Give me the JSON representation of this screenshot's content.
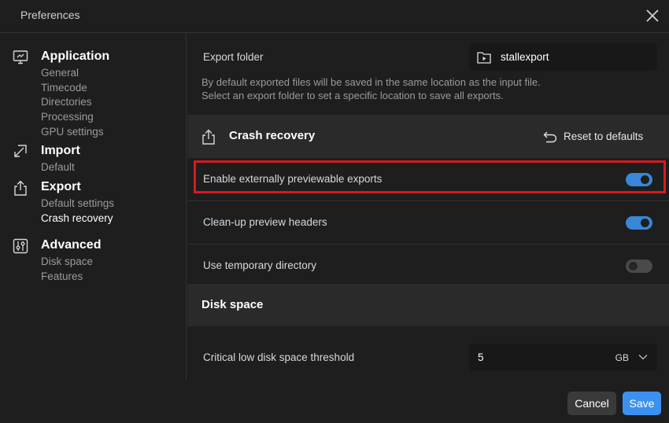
{
  "window": {
    "title": "Preferences"
  },
  "sidebar": {
    "groups": [
      {
        "title": "Application",
        "icon": "monitor-icon",
        "items": [
          "General",
          "Timecode",
          "Directories",
          "Processing",
          "GPU settings"
        ]
      },
      {
        "title": "Import",
        "icon": "import-icon",
        "items": [
          "Default"
        ]
      },
      {
        "title": "Export",
        "icon": "export-icon",
        "items": [
          "Default settings",
          "Crash recovery"
        ],
        "active_item": "Crash recovery"
      },
      {
        "title": "Advanced",
        "icon": "sliders-icon",
        "items": [
          "Disk space",
          "Features"
        ]
      }
    ]
  },
  "content": {
    "export_folder": {
      "label": "Export folder",
      "value": "stallexport",
      "description_line1": "By default exported files will be saved in the same location as the input file.",
      "description_line2": "Select an export folder to set a specific location to save all exports."
    },
    "crash_recovery": {
      "title": "Crash recovery",
      "reset_label": "Reset to defaults",
      "settings": [
        {
          "label": "Enable externally previewable exports",
          "enabled": true
        },
        {
          "label": "Clean-up preview headers",
          "enabled": true
        },
        {
          "label": "Use temporary directory",
          "enabled": false
        }
      ]
    },
    "disk_space": {
      "title": "Disk space",
      "threshold_label": "Critical low disk space threshold",
      "threshold_value": "5",
      "threshold_unit": "GB"
    }
  },
  "footer": {
    "cancel_label": "Cancel",
    "save_label": "Save"
  },
  "colors": {
    "accent": "#3c91f0",
    "toggle_on": "#3a86d8",
    "highlight": "#d8191f",
    "background": "#1e1e1e"
  }
}
